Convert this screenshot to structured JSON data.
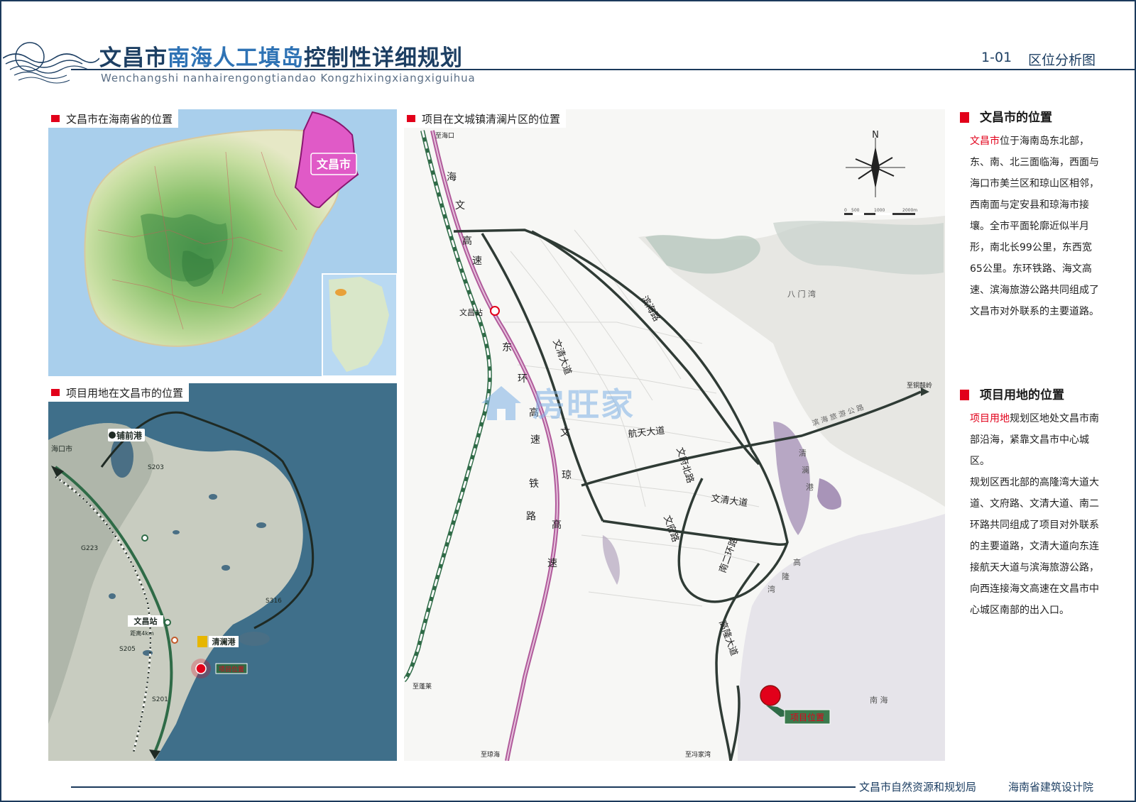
{
  "header": {
    "title_part1": "文昌市",
    "title_part2": "南海人工填岛",
    "title_part3": "控制性详细规划",
    "title_en": "Wenchangshi nanhairengongtiandao Kongzhixingxiangxiguihua",
    "sheet_no": "1-01",
    "sheet_name": "区位分析图"
  },
  "watermark": "房旺家",
  "colors": {
    "accent_red": "#e2001a",
    "header_blue": "#1d3f63",
    "wenchang_area": "#e05ac7",
    "railway": "#b05b9b",
    "expressway": "#2f6b47",
    "road": "#2f3b35",
    "project_marker": "#e2001a"
  },
  "panel_hainan": {
    "label": "文昌市在海南省的位置",
    "highlight_label": "文昌市"
  },
  "panel_wenchang": {
    "label": "项目用地在文昌市的位置",
    "places": [
      "铺前港",
      "海口市",
      "S203",
      "G223",
      "文昌站",
      "距离4km",
      "S205",
      "S201",
      "S316",
      "清澜港",
      "项目位置"
    ]
  },
  "panel_site": {
    "label": "项目在文城镇清澜片区的位置",
    "north": "N",
    "scale": [
      "0",
      "500",
      "1000",
      "2000m"
    ],
    "exits": {
      "haikou": "至海口",
      "penglai": "至蓬莱",
      "qionghai": "至琼海",
      "fengjiawan": "至冯家湾",
      "tonggu": "至铜鼓岭"
    },
    "stations": [
      "文昌站"
    ],
    "road_labels": {
      "haiwen_expressway": [
        "海",
        "文",
        "高",
        "速"
      ],
      "donghuan_railway": [
        "东",
        "环",
        "高",
        "速",
        "铁",
        "路"
      ],
      "wenqiong_expressway": [
        "文",
        "琼",
        "高",
        "速"
      ],
      "wenqing_avenue": "文清大道",
      "binhai_road": "滨海路",
      "hangtian_avenue": "航天大道",
      "wenfu_north_road": "文府北路",
      "wenfu_road": "文府路",
      "gaolongwan_avenue": "高隆大道",
      "nanerhuan_road": "南二环路",
      "coastal_road": "滨 海 旅 游 公 路"
    },
    "water_labels": {
      "bamenwan": "八 门 湾",
      "qinglangang": [
        "清",
        "澜",
        "港"
      ],
      "gaolongwan": [
        "高",
        "隆",
        "湾"
      ],
      "nanhai": "南 海"
    },
    "project_marker_label": "项目位置"
  },
  "side": {
    "sec1": {
      "heading": "文昌市的位置",
      "lead": "文昌市",
      "body": "位于海南岛东北部，东、南、北三面临海，西面与海口市美兰区和琼山区相邻，西南面与定安县和琼海市接壤。全市平面轮廓近似半月形，南北长99公里，东西宽65公里。东环铁路、海文高速、滨海旅游公路共同组成了文昌市对外联系的主要道路。"
    },
    "sec2": {
      "heading": "项目用地的位置",
      "lead": "项目用地",
      "body1": "规划区地处文昌市南部沿海，紧靠文昌市中心城区。",
      "body2": "规划区西北部的高隆湾大道大道、文府路、文清大道、南二环路共同组成了项目对外联系的主要道路，文清大道向东连接航天大道与滨海旅游公路，向西连接海文高速在文昌市中心城区南部的出入口。"
    }
  },
  "footer": {
    "org1": "文昌市自然资源和规划局",
    "org2": "海南省建筑设计院"
  }
}
